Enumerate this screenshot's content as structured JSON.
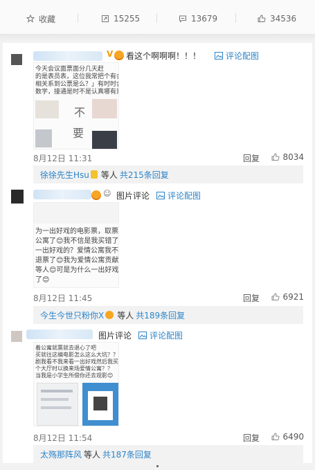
{
  "toolbar": {
    "collect_label": "收藏",
    "repost_count": "15255",
    "comment_count": "13679",
    "like_count": "34536"
  },
  "comments": [
    {
      "text": "看这个啊啊啊！！！",
      "pic_link": "评论配图",
      "date": "8月12日 11:31",
      "reply_label": "回复",
      "likes": "8034",
      "sub_user": "徐徐先生Hsu",
      "sub_mid": "等人",
      "sub_count": "共215条回复",
      "thumb_lines": [
        "今天会议面票面分几天赶",
        "的是表员表，这位我常把个有会❤️",
        "相关系到公票是么？」有时时会，非都",
        "数学，接通是时不是认真哪有是会后"
      ],
      "thumb_chars": [
        "不",
        "要"
      ]
    },
    {
      "text": "图片评论",
      "pic_link": "评论配图",
      "date": "8月12日 11:45",
      "reply_label": "回复",
      "likes": "6921",
      "sub_user": "今生今世只粉你X",
      "sub_mid": "等人",
      "sub_count": "共189条回复",
      "thumb_lines": [
        "为一出好戏的电影票，取票的时",
        "公寓了😊我不信是我买错了😊",
        "一出好戏的？爱情公寓我不看！",
        "退票了😊我为爱情公寓贡献了",
        "等人😊可是为什么一出好戏要",
        "了😊"
      ],
      "thumb_chars": []
    },
    {
      "text": "图片评论",
      "pic_link": "评论配图",
      "date": "8月12日 11:54",
      "reply_label": "回复",
      "likes": "6490",
      "sub_user": "太殇那阵风",
      "sub_mid": "等人",
      "sub_count": "共187条回复",
      "thumb_lines": [
        "着公寓就票就去退心了吧",
        "买就往这编电影怎么这么大坑？？？",
        "剧我看不我来看一出好戏然后我买来一出好戏",
        "个大厅时以换来场爱情公寓？？",
        "当我是小学生所偿你还去观影😊"
      ],
      "thumb_chars": []
    }
  ]
}
